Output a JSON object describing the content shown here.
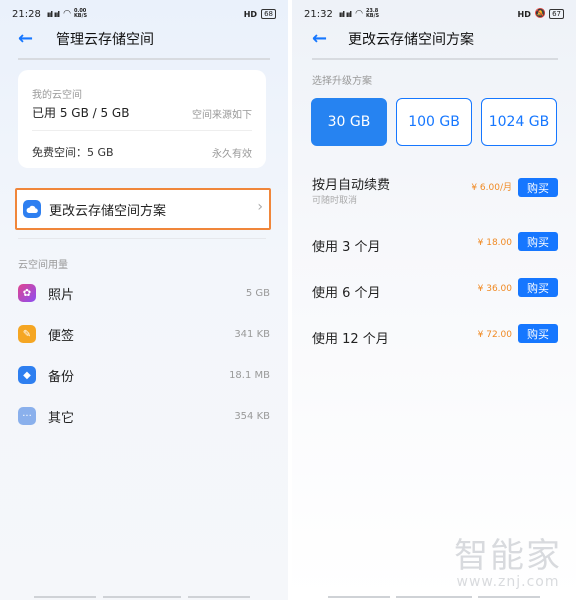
{
  "left": {
    "status": {
      "time": "21:28",
      "signal": "ııl ııl",
      "rate": "0.00 KB/S",
      "hd": "HD",
      "battery": "68"
    },
    "header": {
      "back_icon": "arrow-left-icon",
      "title": "管理云存储空间"
    },
    "storage_card": {
      "heading": "我的云空间",
      "used": "已用 5 GB / 5 GB",
      "source": "空间来源如下",
      "free_label": "免费空间：5 GB",
      "free_term": "永久有效"
    },
    "change_plan": {
      "icon": "cloud-icon",
      "label": "更改云存储空间方案",
      "chevron": "chevron-right-icon",
      "highlight": "#f0863a"
    },
    "usage": {
      "heading": "云空间用量",
      "items": [
        {
          "icon": "photos-icon",
          "label": "照片",
          "value": "5 GB",
          "color": "#a246e8"
        },
        {
          "icon": "notes-icon",
          "label": "便签",
          "value": "341 KB",
          "color": "#f5a623"
        },
        {
          "icon": "backup-icon",
          "label": "备份",
          "value": "18.1 MB",
          "color": "#2e7ff0"
        },
        {
          "icon": "more-icon",
          "label": "其它",
          "value": "354 KB",
          "color": "#8ab0ec"
        }
      ]
    }
  },
  "right": {
    "status": {
      "time": "21:32",
      "signal": "ııl ııl",
      "rate": "23.8 KB/S",
      "hd": "HD",
      "battery": "67"
    },
    "header": {
      "back_icon": "arrow-left-icon",
      "title": "更改云存储空间方案"
    },
    "plans": {
      "heading": "选择升级方案",
      "options": [
        "30 GB",
        "100 GB",
        "1024 GB"
      ],
      "selected": "30 GB"
    },
    "purchase_options": [
      {
        "label": "按月自动续费",
        "sub": "可随时取消",
        "price": "¥ 6.00/月",
        "button": "购买"
      },
      {
        "label": "使用 3 个月",
        "sub": "",
        "price": "¥ 18.00",
        "button": "购买"
      },
      {
        "label": "使用 6 个月",
        "sub": "",
        "price": "¥ 36.00",
        "button": "购买"
      },
      {
        "label": "使用 12 个月",
        "sub": "",
        "price": "¥ 72.00",
        "button": "购买"
      }
    ]
  },
  "watermark": {
    "main": "智能家",
    "sub": "www.znj.com"
  },
  "colors": {
    "accent": "#1677ff",
    "price": "#f08a24",
    "highlight": "#f0863a"
  }
}
